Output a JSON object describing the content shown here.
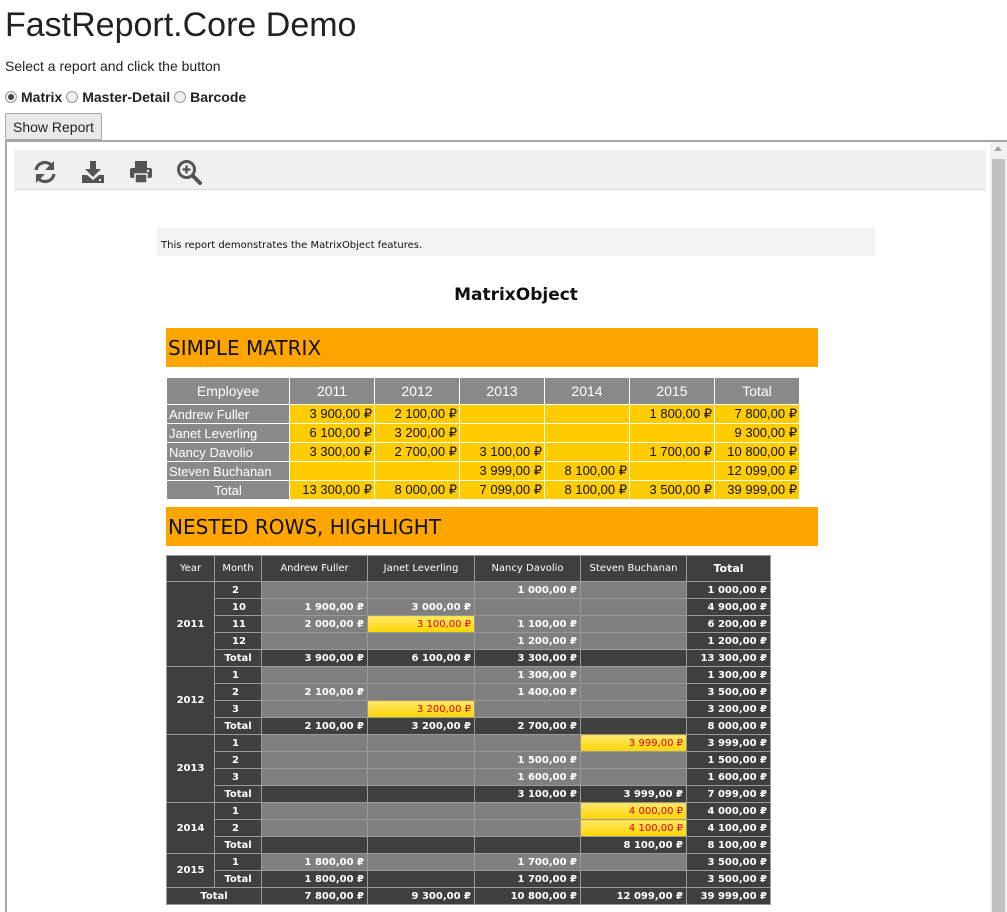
{
  "page": {
    "title": "FastReport.Core Demo",
    "subtitle": "Select a report and click the button",
    "radios": [
      {
        "label": "Matrix",
        "checked": true
      },
      {
        "label": "Master-Detail",
        "checked": false
      },
      {
        "label": "Barcode",
        "checked": false
      }
    ],
    "show_button": "Show Report"
  },
  "toolbar": [
    "refresh-icon",
    "download-icon",
    "print-icon",
    "zoom-icon"
  ],
  "report": {
    "note": "This report demonstrates the MatrixObject features.",
    "title": "MatrixObject",
    "simple": {
      "band": "SIMPLE MATRIX",
      "headers": [
        "Employee",
        "2011",
        "2012",
        "2013",
        "2014",
        "2015",
        "Total"
      ],
      "rows": [
        {
          "name": "Andrew Fuller",
          "values": [
            "3 900,00 ₽",
            "2 100,00 ₽",
            "",
            "",
            "1 800,00 ₽",
            "7 800,00 ₽"
          ]
        },
        {
          "name": "Janet Leverling",
          "values": [
            "6 100,00 ₽",
            "3 200,00 ₽",
            "",
            "",
            "",
            "9 300,00 ₽"
          ]
        },
        {
          "name": "Nancy Davolio",
          "values": [
            "3 300,00 ₽",
            "2 700,00 ₽",
            "3 100,00 ₽",
            "",
            "1 700,00 ₽",
            "10 800,00 ₽"
          ]
        },
        {
          "name": "Steven Buchanan",
          "values": [
            "",
            "",
            "3 999,00 ₽",
            "8 100,00 ₽",
            "",
            "12 099,00 ₽"
          ]
        }
      ],
      "total": {
        "name": "Total",
        "values": [
          "13 300,00 ₽",
          "8 000,00 ₽",
          "7 099,00 ₽",
          "8 100,00 ₽",
          "3 500,00 ₽",
          "39 999,00 ₽"
        ]
      }
    },
    "nested": {
      "band": "NESTED ROWS, HIGHLIGHT",
      "headers": [
        "Year",
        "Month",
        "Andrew Fuller",
        "Janet Leverling",
        "Nancy Davolio",
        "Steven Buchanan",
        "Total"
      ],
      "groups": [
        {
          "year": "2011",
          "rows": [
            {
              "month": "2",
              "cells": [
                "",
                "",
                "1 000,00 ₽",
                "",
                "1 000,00 ₽"
              ]
            },
            {
              "month": "10",
              "cells": [
                "1 900,00 ₽",
                "3 000,00 ₽",
                "",
                "",
                "4 900,00 ₽"
              ]
            },
            {
              "month": "11",
              "cells": [
                "2 000,00 ₽",
                "3 100,00 ₽",
                "1 100,00 ₽",
                "",
                "6 200,00 ₽"
              ],
              "highlight": [
                1
              ]
            },
            {
              "month": "12",
              "cells": [
                "",
                "",
                "1 200,00 ₽",
                "",
                "1 200,00 ₽"
              ]
            },
            {
              "month": "Total",
              "total": true,
              "cells": [
                "3 900,00 ₽",
                "6 100,00 ₽",
                "3 300,00 ₽",
                "",
                "13 300,00 ₽"
              ]
            }
          ]
        },
        {
          "year": "2012",
          "rows": [
            {
              "month": "1",
              "cells": [
                "",
                "",
                "1 300,00 ₽",
                "",
                "1 300,00 ₽"
              ]
            },
            {
              "month": "2",
              "cells": [
                "2 100,00 ₽",
                "",
                "1 400,00 ₽",
                "",
                "3 500,00 ₽"
              ]
            },
            {
              "month": "3",
              "cells": [
                "",
                "3 200,00 ₽",
                "",
                "",
                "3 200,00 ₽"
              ],
              "highlight": [
                1
              ]
            },
            {
              "month": "Total",
              "total": true,
              "cells": [
                "2 100,00 ₽",
                "3 200,00 ₽",
                "2 700,00 ₽",
                "",
                "8 000,00 ₽"
              ]
            }
          ]
        },
        {
          "year": "2013",
          "rows": [
            {
              "month": "1",
              "cells": [
                "",
                "",
                "",
                "3 999,00 ₽",
                "3 999,00 ₽"
              ],
              "highlight": [
                3
              ]
            },
            {
              "month": "2",
              "cells": [
                "",
                "",
                "1 500,00 ₽",
                "",
                "1 500,00 ₽"
              ]
            },
            {
              "month": "3",
              "cells": [
                "",
                "",
                "1 600,00 ₽",
                "",
                "1 600,00 ₽"
              ]
            },
            {
              "month": "Total",
              "total": true,
              "cells": [
                "",
                "",
                "3 100,00 ₽",
                "3 999,00 ₽",
                "7 099,00 ₽"
              ]
            }
          ]
        },
        {
          "year": "2014",
          "rows": [
            {
              "month": "1",
              "cells": [
                "",
                "",
                "",
                "4 000,00 ₽",
                "4 000,00 ₽"
              ],
              "highlight": [
                3
              ]
            },
            {
              "month": "2",
              "cells": [
                "",
                "",
                "",
                "4 100,00 ₽",
                "4 100,00 ₽"
              ],
              "highlight": [
                3
              ]
            },
            {
              "month": "Total",
              "total": true,
              "cells": [
                "",
                "",
                "",
                "8 100,00 ₽",
                "8 100,00 ₽"
              ]
            }
          ]
        },
        {
          "year": "2015",
          "rows": [
            {
              "month": "1",
              "cells": [
                "1 800,00 ₽",
                "",
                "1 700,00 ₽",
                "",
                "3 500,00 ₽"
              ]
            },
            {
              "month": "Total",
              "total": true,
              "cells": [
                "1 800,00 ₽",
                "",
                "1 700,00 ₽",
                "",
                "3 500,00 ₽"
              ]
            }
          ]
        }
      ],
      "grand_total": {
        "label": "Total",
        "cells": [
          "7 800,00 ₽",
          "9 300,00 ₽",
          "10 800,00 ₽",
          "12 099,00 ₽",
          "39 999,00 ₽"
        ]
      }
    }
  }
}
